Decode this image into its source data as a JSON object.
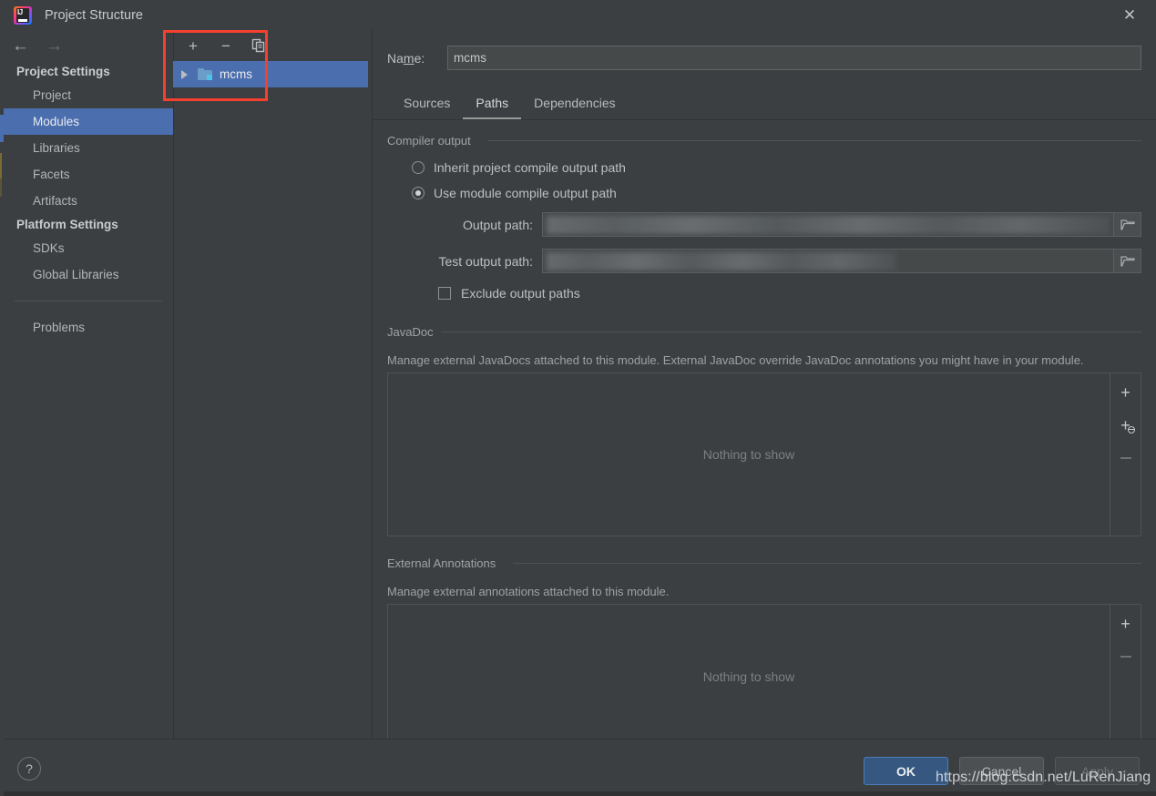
{
  "window": {
    "title": "Project Structure",
    "app_icon": "intellij-idea-logo",
    "close_icon": "✕"
  },
  "nav": {
    "back_icon": "←",
    "forward_icon": "→"
  },
  "sidebar": {
    "groups": [
      {
        "label": "Project Settings",
        "items": [
          {
            "label": "Project",
            "selected": false
          },
          {
            "label": "Modules",
            "selected": true
          },
          {
            "label": "Libraries",
            "selected": false
          },
          {
            "label": "Facets",
            "selected": false
          },
          {
            "label": "Artifacts",
            "selected": false
          }
        ]
      },
      {
        "label": "Platform Settings",
        "items": [
          {
            "label": "SDKs",
            "selected": false
          },
          {
            "label": "Global Libraries",
            "selected": false
          }
        ]
      }
    ],
    "problems_label": "Problems"
  },
  "modules_panel": {
    "toolbar": {
      "add_label": "+",
      "remove_label": "−",
      "copy_icon": "copy-icon"
    },
    "tree": [
      {
        "label": "mcms",
        "selected": true,
        "expander": "▶",
        "icon": "module-folder-icon"
      }
    ]
  },
  "module_editor": {
    "name_label_prefix": "Na",
    "name_label_mnemonic": "m",
    "name_label_suffix": "e:",
    "name_value": "mcms",
    "tabs": [
      {
        "label": "Sources",
        "active": false
      },
      {
        "label": "Paths",
        "active": true
      },
      {
        "label": "Dependencies",
        "active": false
      }
    ],
    "compiler_output": {
      "group_label": "Compiler output",
      "inherit_label": "Inherit project compile output path",
      "inherit_selected": false,
      "use_module_label": "Use module compile output path",
      "use_module_selected": true,
      "output_path_label": "Output path:",
      "output_path_value": "",
      "test_output_path_label": "Test output path:",
      "test_output_path_value": "",
      "browse_icon": "folder-icon",
      "exclude_label": "Exclude output paths",
      "exclude_checked": false
    },
    "javadoc": {
      "group_label": "JavaDoc",
      "description": "Manage external JavaDocs attached to this module. External JavaDoc override JavaDoc annotations you might have in your module.",
      "empty_text": "Nothing to show",
      "buttons": [
        {
          "name": "add",
          "glyph": "+",
          "enabled": true
        },
        {
          "name": "add-url",
          "glyph": "+",
          "enabled": true
        },
        {
          "name": "remove",
          "glyph": "−",
          "enabled": false
        }
      ]
    },
    "external_annotations": {
      "group_label": "External Annotations",
      "description": "Manage external annotations attached to this module.",
      "empty_text": "Nothing to show",
      "buttons": [
        {
          "name": "add",
          "glyph": "+",
          "enabled": true
        },
        {
          "name": "remove",
          "glyph": "−",
          "enabled": false
        }
      ]
    }
  },
  "footer": {
    "help_label": "?",
    "ok_label": "OK",
    "cancel_label": "Cancel",
    "apply_label": "Apply"
  },
  "watermark": {
    "text": "https://blog.csdn.net/LuRenJiang"
  },
  "colors": {
    "background": "#3c3f41",
    "selection_blue": "#4b6eaf",
    "ok_button": "#365880",
    "annotation_red": "#f4402e",
    "text_primary": "#bdbfc1",
    "text_muted": "#9fa2a5"
  }
}
